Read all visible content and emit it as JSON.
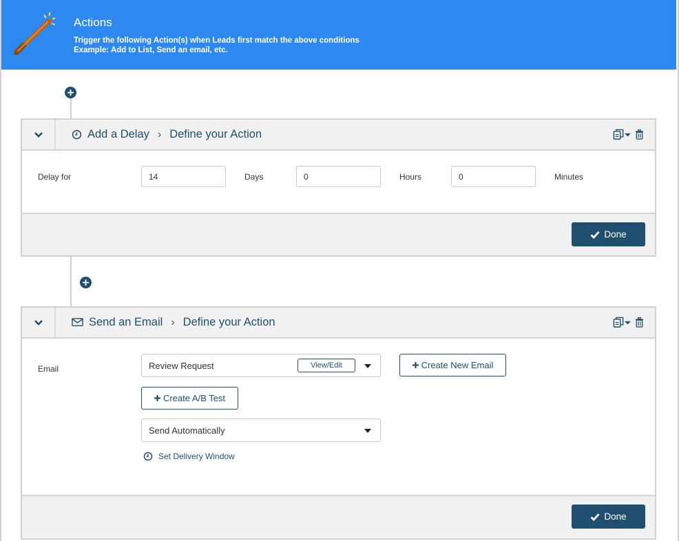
{
  "header": {
    "title": "Actions",
    "description_line1": "Trigger the following Action(s) when Leads first match the above conditions",
    "description_line2": "Example: Add to List, Send an email, etc.",
    "background": "#2d89ef"
  },
  "accent_color": "#1f4e6e",
  "delay_card": {
    "breadcrumb_action": "Add a Delay",
    "breadcrumb_step": "Define your Action",
    "action_icon": "clock-icon",
    "delay_label": "Delay for",
    "days_value": "14",
    "days_label": "Days",
    "hours_value": "0",
    "hours_label": "Hours",
    "minutes_value": "0",
    "minutes_label": "Minutes",
    "done_label": "Done"
  },
  "email_card": {
    "breadcrumb_action": "Send an Email",
    "breadcrumb_step": "Define your Action",
    "action_icon": "envelope-icon",
    "email_label": "Email",
    "email_selected": "Review Request",
    "view_edit_label": "View/Edit",
    "create_new_email_label": "Create New Email",
    "create_ab_test_label": "Create A/B Test",
    "send_mode_selected": "Send Automatically",
    "delivery_window_label": "Set Delivery Window",
    "done_label": "Done"
  }
}
